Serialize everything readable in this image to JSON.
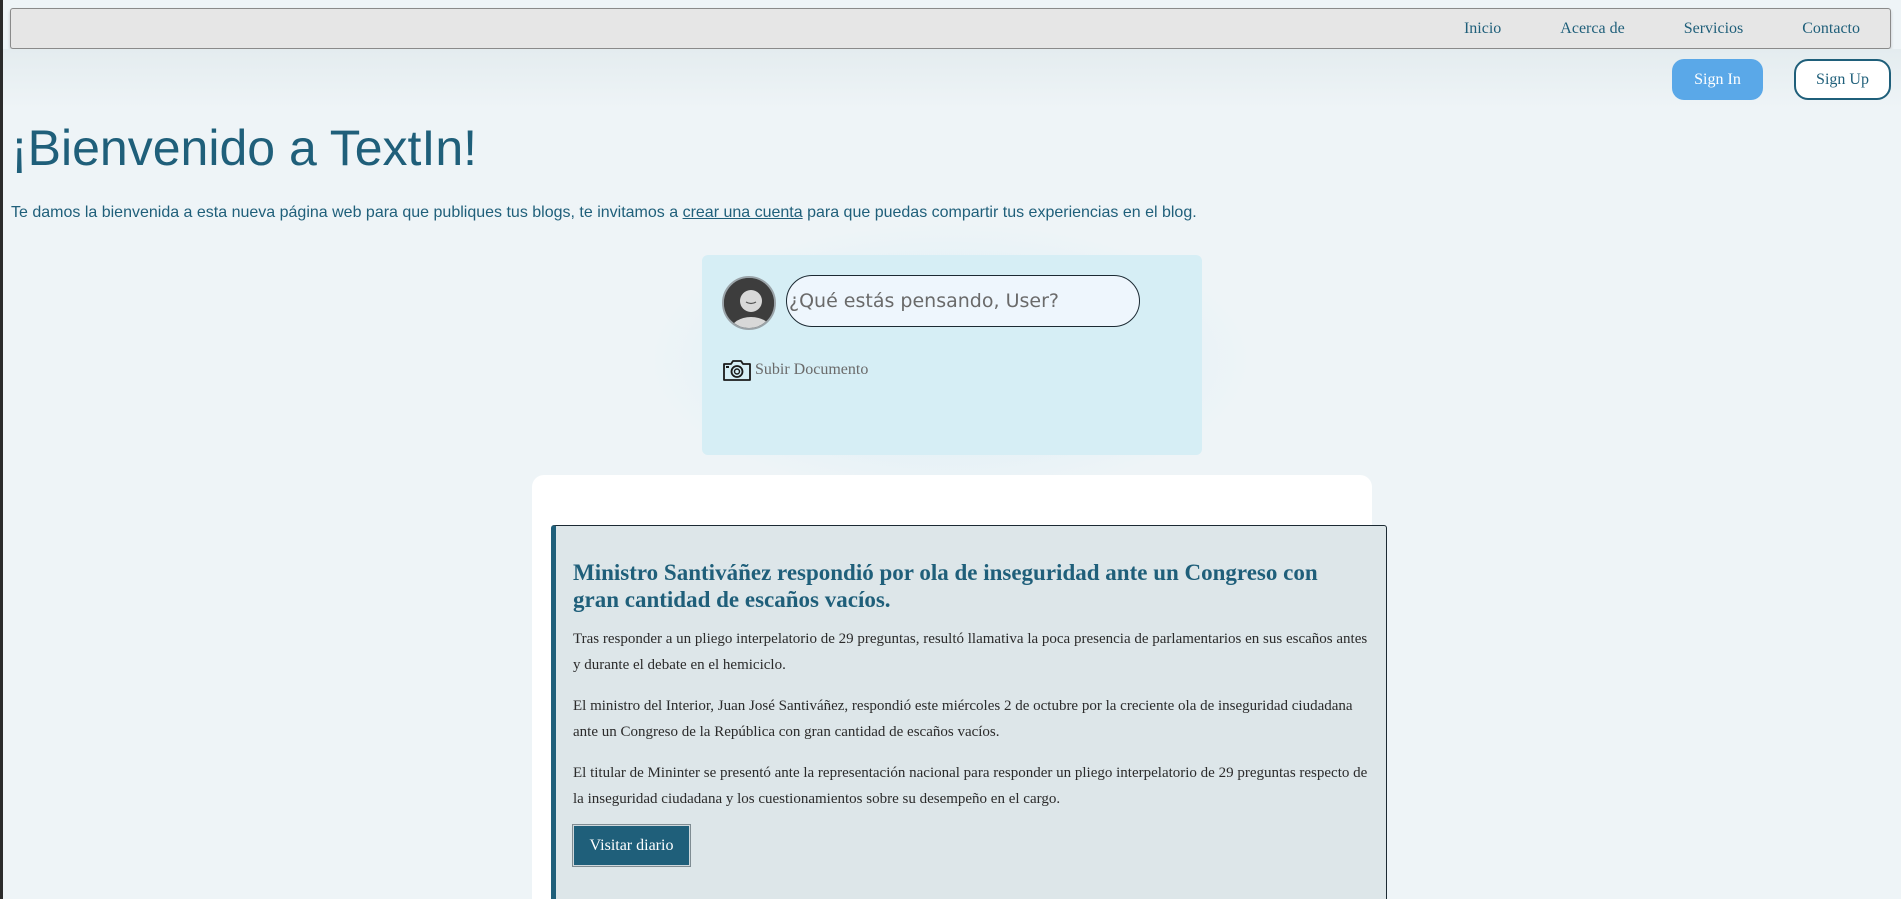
{
  "nav": {
    "items": [
      "Inicio",
      "Acerca de",
      "Servicios",
      "Contacto"
    ]
  },
  "auth": {
    "sign_in": "Sign In",
    "sign_up": "Sign Up"
  },
  "welcome": {
    "title": "¡Bienvenido a TextIn!",
    "text_before": "Te damos la bienvenida a esta nueva página web para que publiques tus blogs, te invitamos a ",
    "link": "crear una cuenta",
    "text_after": " para que puedas compartir tus experiencias en el blog."
  },
  "composer": {
    "placeholder": "¿Qué estás pensando, User?",
    "upload_label": "Subir Documento"
  },
  "article": {
    "title": "Ministro Santiváñez respondió por ola de inseguridad ante un Congreso con gran cantidad de escaños vacíos.",
    "paragraphs": [
      "Tras responder a un pliego interpelatorio de 29 preguntas, resultó llamativa la poca presencia de parlamentarios en sus escaños antes y durante el debate en el hemiciclo.",
      "El ministro del Interior, Juan José Santiváñez, respondió este miércoles 2 de octubre por la creciente ola de inseguridad ciudadana ante un Congreso de la República con gran cantidad de escaños vacíos.",
      "El titular de Mininter se presentó ante la representación nacional para responder un pliego interpelatorio de 29 preguntas respecto de la inseguridad ciudadana y los cuestionamientos sobre su desempeño en el cargo."
    ],
    "button": "Visitar diario"
  },
  "icons": {
    "avatar": "user-avatar-icon",
    "upload": "camera-icon"
  },
  "colors": {
    "primary": "#1f5f7a",
    "sign_in_bg": "#5aa8e8",
    "page_bg": "#eef4f7",
    "composer_bg": "#d6eef5",
    "article_bg": "#dde6e9"
  }
}
